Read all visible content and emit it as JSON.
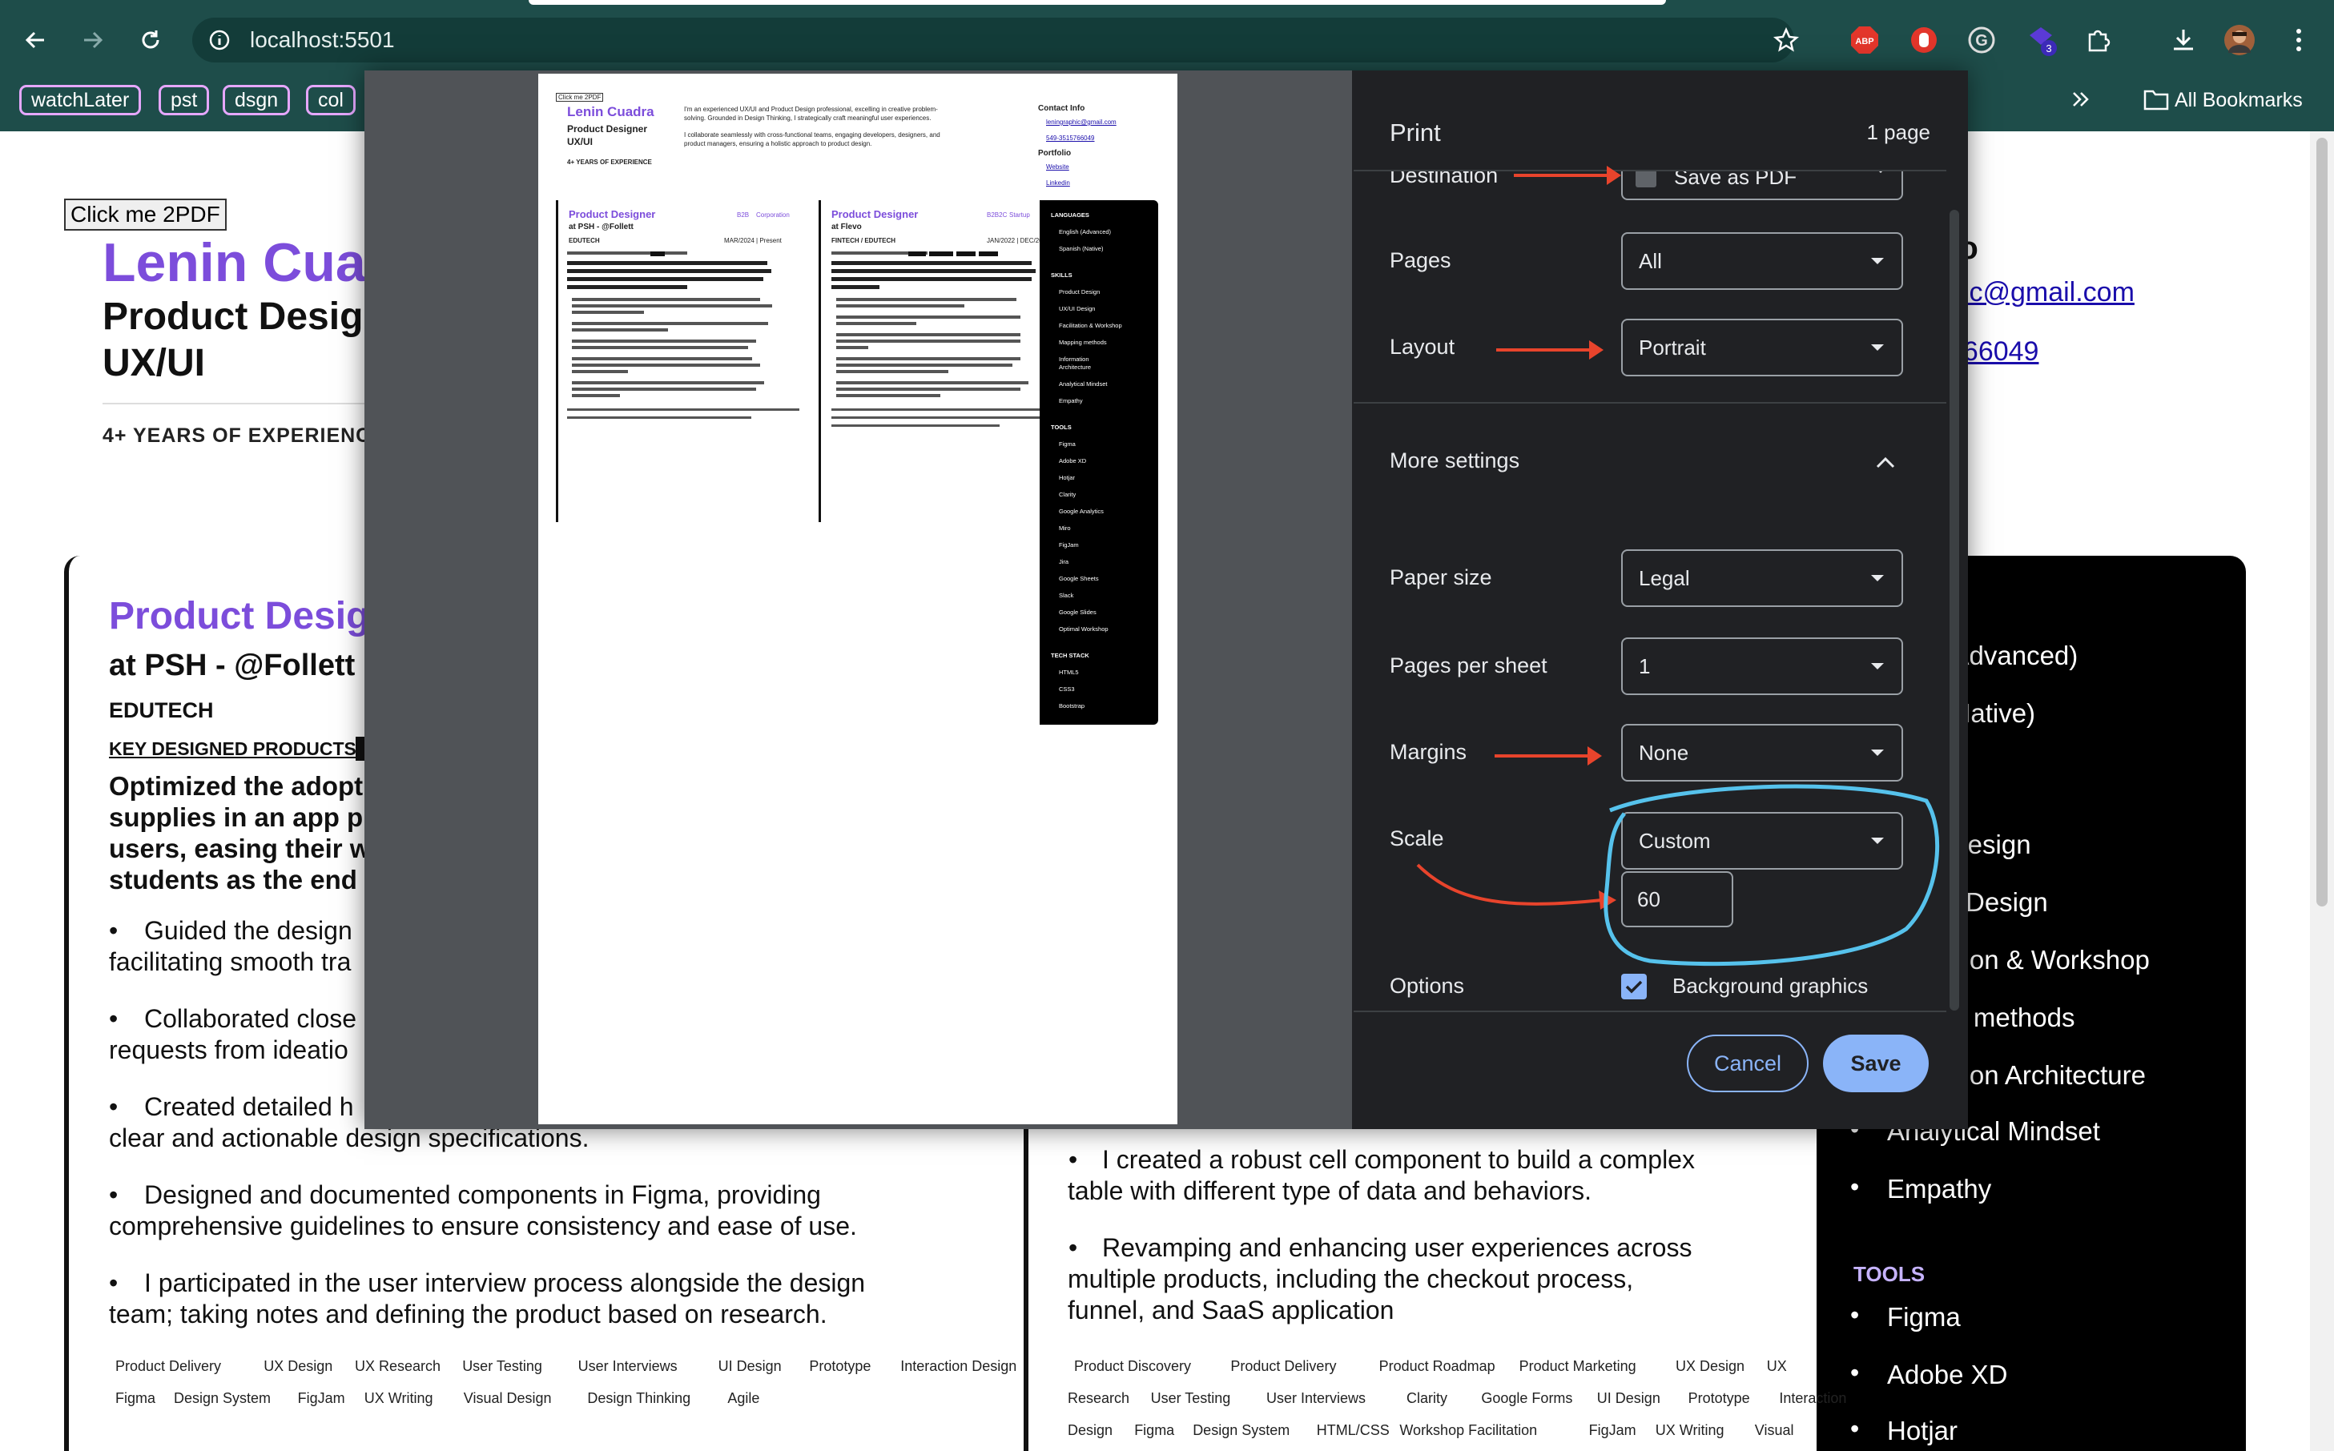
{
  "browser": {
    "url": "localhost:5501",
    "bookmarks": [
      "watchLater",
      "pst",
      "dsgn",
      "col"
    ],
    "all_bookmarks": "All Bookmarks",
    "extension_badge": "3",
    "accent": "#1e4d4a"
  },
  "page": {
    "pdf_button": "Click me 2PDF",
    "name": "Lenin Cuac",
    "role": "Product Desig",
    "role2": "UX/UI",
    "years": "4+ YEARS OF EXPERIENCE",
    "contact_title": "fo",
    "email_fragment": "nic@gmail.com",
    "phone_fragment": "766049",
    "job1": {
      "title": "Product Desig",
      "company": "at PSH - @Follett",
      "sector": "EDUTECH",
      "products_label": "KEY DESIGNED PRODUCTS",
      "summary": [
        "Optimized the adopti",
        "supplies in an app pr",
        "users, easing their w",
        "students as the end u"
      ],
      "bullets": [
        [
          "Guided the design",
          "facilitating smooth tra"
        ],
        [
          "Collaborated close",
          "requests from ideatio"
        ],
        [
          "Created detailed h",
          "clear and actionable design specifications."
        ],
        [
          "Designed and documented components in Figma, providing",
          "comprehensive guidelines to ensure consistency and ease of use."
        ],
        [
          "I participated in the user interview process alongside the design",
          "team; taking notes and defining the product based on research."
        ]
      ],
      "tags_row1": [
        "Product Delivery",
        "UX Design",
        "UX Research",
        "User Testing",
        "User Interviews",
        "UI Design",
        "Prototype",
        "Interaction Design"
      ],
      "tags_row2": [
        "Figma",
        "Design System",
        "FigJam",
        "UX Writing",
        "Visual Design",
        "Design Thinking",
        "Agile"
      ]
    },
    "job2": {
      "bullets": [
        [
          "I created a robust cell component to build a complex",
          "table with different type of data and behaviors."
        ],
        [
          "Revamping and enhancing user experiences across",
          "multiple products, including the checkout process,",
          "funnel, and SaaS application"
        ]
      ],
      "tags_row1": [
        "Product Discovery",
        "Product Delivery",
        "Product Roadmap",
        "Product Marketing",
        "UX Design",
        "UX"
      ],
      "tags_row2": [
        "Research",
        "User Testing",
        "User Interviews",
        "Clarity",
        "Google Forms",
        "UI Design",
        "Prototype",
        "Interaction"
      ],
      "tags_row3": [
        "Design",
        "Figma",
        "Design System",
        "HTML/CSS",
        "Workshop Facilitation",
        "FigJam",
        "UX Writing",
        "Visual"
      ]
    },
    "sidebar": {
      "languages_fragment": "s",
      "lang1": "n (Advanced)",
      "lang2": "h (Native)",
      "skills": [
        "ct Design",
        "Design",
        "ation & Workshop",
        "ng methods",
        "ation Architecture",
        "Analytical Mindset",
        "Empathy"
      ],
      "tools_title": "TOOLS",
      "tools": [
        "Figma",
        "Adobe XD",
        "Hotjar"
      ]
    }
  },
  "print_dialog": {
    "title": "Print",
    "page_count": "1 page",
    "destination_label": "Destination",
    "destination_value": "Save as PDF",
    "pages_label": "Pages",
    "pages_value": "All",
    "layout_label": "Layout",
    "layout_value": "Portrait",
    "more_settings": "More settings",
    "paper_size_label": "Paper size",
    "paper_size_value": "Legal",
    "pages_per_sheet_label": "Pages per sheet",
    "pages_per_sheet_value": "1",
    "margins_label": "Margins",
    "margins_value": "None",
    "scale_label": "Scale",
    "scale_value": "Custom",
    "scale_number": "60",
    "options_label": "Options",
    "background_graphics": "Background graphics",
    "cancel": "Cancel",
    "save": "Save"
  },
  "preview": {
    "btn": "Click me 2PDF",
    "name": "Lenin Cuadra",
    "role": "Product Designer",
    "role2": "UX/UI",
    "years": "4+ YEARS OF EXPERIENCE",
    "intro1": "I'm an experienced UX/UI and Product Design professional, excelling in creative problem-",
    "intro2": "solving. Grounded in Design Thinking, I strategically craft meaningful user experiences.",
    "intro3": "I collaborate seamlessly with cross-functional teams, engaging developers, designers, and",
    "intro4": "product managers, ensuring a holistic approach to product design.",
    "contact": "Contact Info",
    "email": "leningraphic@gmail.com",
    "phone": "549-3515766049",
    "portfolio": "Portfolio",
    "website": "Website",
    "linkedin": "Linkedin",
    "j1_title": "Product Designer",
    "j1_co": "at PSH - @Follett",
    "j1_tag1": "B2B",
    "j1_tag2": "Corporation",
    "j1_sector": "EDUTECH",
    "j1_date": "MAR/2024 | Present",
    "j2_title": "Product Designer",
    "j2_co": "at Flevo",
    "j2_tag1": "B2B2C",
    "j2_tag2": "Startup",
    "j2_sector": "FINTECH / EDUTECH",
    "j2_date": "JAN/2022 | DEC/2023",
    "side": [
      "LANGUAGES",
      "English (Advanced)",
      "Spanish (Native)",
      "SKILLS",
      "Product Design",
      "UX/UI Design",
      "Facilitation & Workshop",
      "Mapping methods",
      "Information",
      "Architecture",
      "Analytical Mindset",
      "Empathy",
      "TOOLS",
      "Figma",
      "Adobe XD",
      "Hotjar",
      "Clarity",
      "Google Analytics",
      "Miro",
      "FigJam",
      "Jira",
      "Google Sheets",
      "Slack",
      "Google Slides",
      "Optimal Workshop",
      "TECH STACK",
      "HTML5",
      "CSS3",
      "Bootstrap"
    ]
  }
}
